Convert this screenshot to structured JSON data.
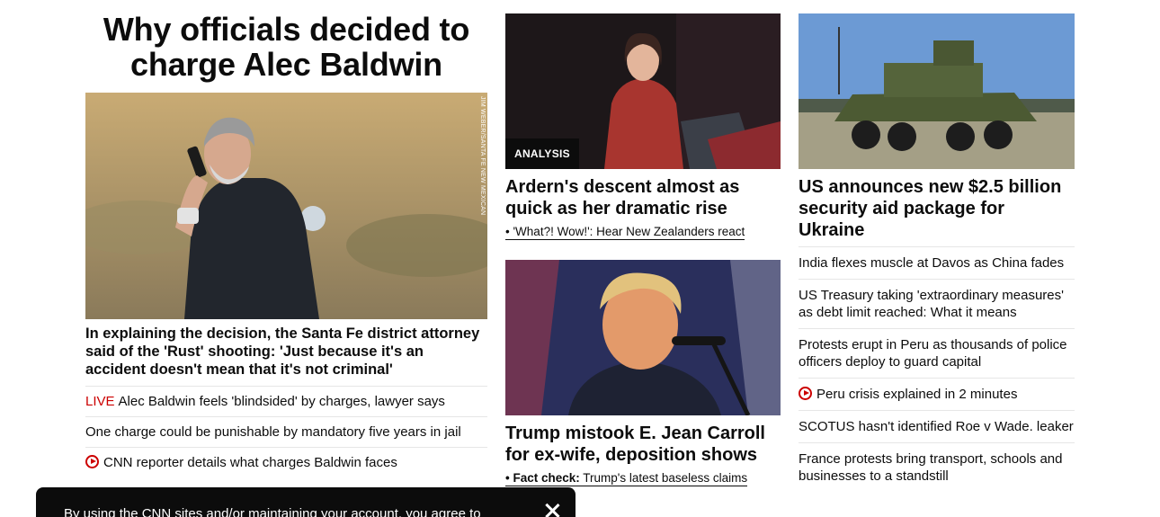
{
  "lead": {
    "title": "Why officials decided to charge Alec Baldwin",
    "image_credit": "JIM WEBER/SANTA FE NEW MEXICAN",
    "headline": "In explaining the decision, the Santa Fe district attorney said of the 'Rust' shooting: 'Just because it's an accident doesn't mean that it's not criminal'",
    "links": [
      {
        "prefix": "LIVE",
        "text": "Alec Baldwin feels 'blindsided' by charges, lawyer says"
      },
      {
        "text": "One charge could be punishable by mandatory five years in jail"
      },
      {
        "icon": "play-icon",
        "text": "CNN reporter details what charges Baldwin faces"
      }
    ]
  },
  "middle": {
    "card1": {
      "badge": "ANALYSIS",
      "headline": "Ardern's descent almost as quick as her dramatic rise",
      "sub_link": "• 'What?! Wow!': Hear New Zealanders react"
    },
    "card2": {
      "headline": "Trump mistook E. Jean Carroll for ex-wife, deposition shows",
      "sub_prefix": "• Fact check:",
      "sub_link": " Trump's latest baseless claims"
    }
  },
  "right": {
    "headline": "US announces new $2.5 billion security aid package for Ukraine",
    "links": [
      {
        "text": "India flexes muscle at Davos as China fades"
      },
      {
        "text": "US Treasury taking 'extraordinary measures' as debt limit reached: What it means"
      },
      {
        "text": "Protests erupt in Peru as thousands of police officers deploy to guard capital"
      },
      {
        "icon": "play-icon",
        "text": "Peru crisis explained in 2 minutes"
      },
      {
        "text": "SCOTUS hasn't identified Roe v Wade. leaker"
      },
      {
        "text": "France protests bring transport, schools and businesses to a standstill"
      }
    ]
  },
  "cookie_banner": {
    "text": "By using the CNN sites and/or maintaining your account, you agree to"
  },
  "colors": {
    "live": "#cc0000",
    "text": "#0c0c0c",
    "divider": "#e6e6e6"
  }
}
